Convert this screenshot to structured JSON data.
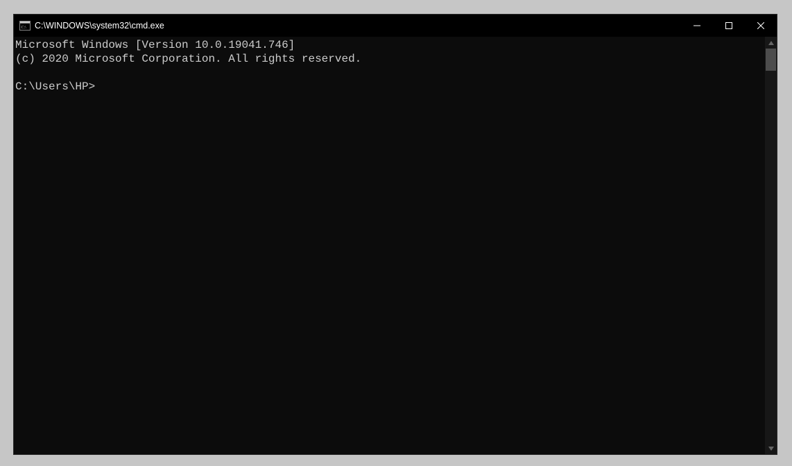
{
  "titlebar": {
    "title": "C:\\WINDOWS\\system32\\cmd.exe"
  },
  "terminal": {
    "line1": "Microsoft Windows [Version 10.0.19041.746]",
    "line2": "(c) 2020 Microsoft Corporation. All rights reserved.",
    "prompt": "C:\\Users\\HP>"
  }
}
